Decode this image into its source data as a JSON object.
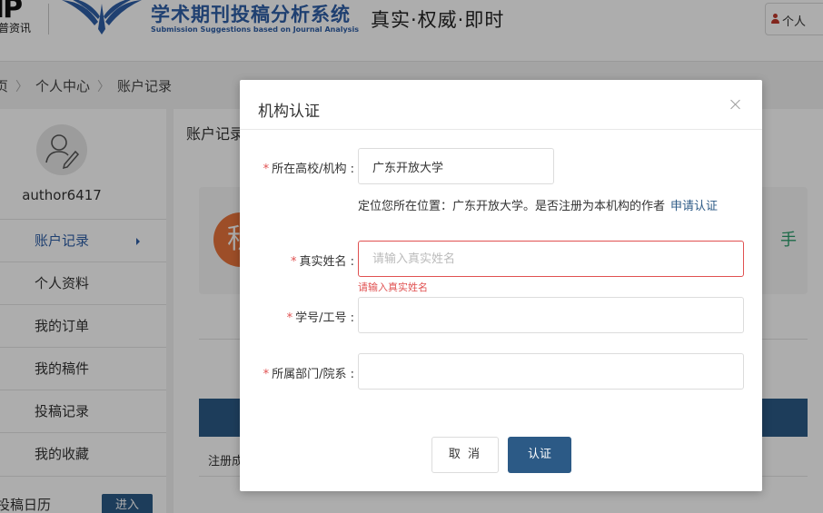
{
  "header": {
    "logo_mark": "IP",
    "logo_sub": "普资讯",
    "site_title": "学术期刊投稿分析系统",
    "site_subtitle": "Submission Suggestions based on Journal Analysis",
    "slogan": "真实·权威·即时",
    "user_menu_label": "个人"
  },
  "breadcrumb": {
    "items": [
      "页",
      "个人中心",
      "账户记录"
    ],
    "separator": "〉"
  },
  "sidebar": {
    "username": "author6417",
    "items": [
      {
        "label": "账户记录",
        "active": true
      },
      {
        "label": "个人资料",
        "active": false
      },
      {
        "label": "我的订单",
        "active": false
      },
      {
        "label": "我的稿件",
        "active": false
      },
      {
        "label": "投稿记录",
        "active": false
      },
      {
        "label": "我的收藏",
        "active": false
      }
    ],
    "bottom_label": "投稿日历",
    "enter_button": "进入"
  },
  "main": {
    "title": "账户记录",
    "card_circle_char": "积",
    "card_right_char": "手",
    "table_row_text": "注册成"
  },
  "modal": {
    "title": "机构认证",
    "fields": {
      "institution": {
        "label": "所在高校/机构 :",
        "value": "广东开放大学"
      },
      "real_name": {
        "label": "真实姓名 :",
        "placeholder": "请输入真实姓名",
        "error": "请输入真实姓名"
      },
      "student_id": {
        "label": "学号/工号 :",
        "placeholder": ""
      },
      "department": {
        "label": "所属部门/院系 :",
        "placeholder": ""
      }
    },
    "hint": "定位您所在位置：广东开放大学。是否注册为本机构的作者",
    "hint_link": "申请认证",
    "cancel_label": "取 消",
    "confirm_label": "认证"
  },
  "colors": {
    "brand_blue": "#2c5a86",
    "title_blue": "#2f5fa7",
    "error_red": "#e05151",
    "overlay": "rgba(0,0,0,0.32)"
  },
  "icons": {
    "user_menu": "user-icon",
    "avatar": "avatar-user-edit-icon",
    "close": "close-icon",
    "sidebar_active_arrow": "caret-right-icon"
  }
}
